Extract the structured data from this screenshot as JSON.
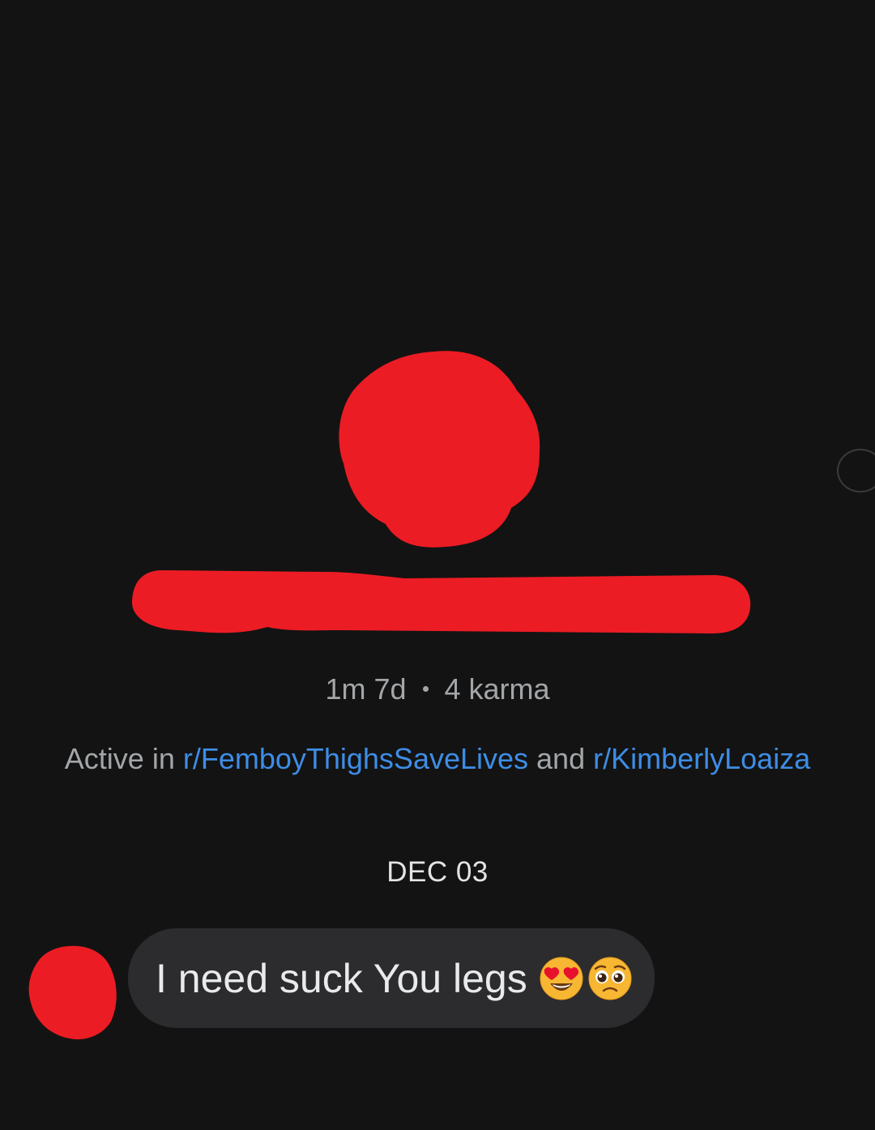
{
  "profile": {
    "age": "1m 7d",
    "karma": "4 karma",
    "active_prefix": "Active in ",
    "community_1": "r/FemboyThighsSaveLives",
    "active_joiner": " and ",
    "community_2": "r/KimberlyLoaiza"
  },
  "chat": {
    "date_separator": "DEC 03",
    "messages": [
      {
        "text": "I need suck You legs",
        "emojis": [
          "heart-eyes-emoji",
          "pleading-face-emoji"
        ]
      }
    ]
  },
  "colors": {
    "background": "#131313",
    "redaction": "#ec1c24",
    "link": "#3e8de5",
    "bubble": "#2c2c2e",
    "muted_text": "#a3a6a8"
  }
}
